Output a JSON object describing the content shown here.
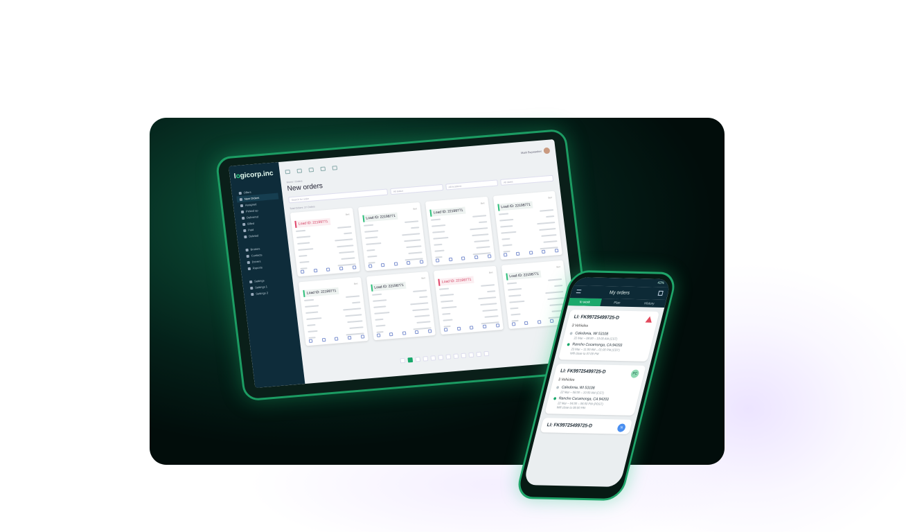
{
  "tablet": {
    "logo_prefix": "l",
    "logo_mid": "gicorp",
    "logo_suffix": ".inc",
    "user_name": "Mark Buyweeker",
    "breadcrumb": "Home / Orders",
    "page_title": "New orders",
    "filters": [
      "Search for order",
      "All status",
      "All locations",
      "All dates"
    ],
    "orders_label": "Total Orders: 37 Orders",
    "nav": [
      "Offers",
      "New Orders",
      "Assigned",
      "Picked up",
      "Delivered",
      "Billed",
      "Paid",
      "Deleted",
      "Brokers",
      "Contacts",
      "Drivers",
      "Reports",
      "Settings",
      "Settings 1",
      "Settings 2"
    ],
    "nav_active_index": 1,
    "orders": [
      {
        "load_id": "Load ID: 22198771",
        "alert": true
      },
      {
        "load_id": "Load ID: 22198771",
        "alert": false
      },
      {
        "load_id": "Load ID: 22198771",
        "alert": false
      },
      {
        "load_id": "Load ID: 22198771",
        "alert": false
      },
      {
        "load_id": "Load ID: 22198771",
        "alert": false
      },
      {
        "load_id": "Load ID: 22198771",
        "alert": false
      },
      {
        "load_id": "Load ID: 22198771",
        "alert": true
      },
      {
        "load_id": "Load ID: 22198771",
        "alert": false
      }
    ],
    "badge": "Bert",
    "pages": 12,
    "current_page": 2
  },
  "phone": {
    "battery": "42%",
    "title": "My orders",
    "tabs": [
      "In work",
      "Plan",
      "History"
    ],
    "active_tab": 0,
    "shipments": [
      {
        "id": "LI: FK99725499725-D",
        "vehicles": "3 Vehicles",
        "origin": "Caledonia, WI 53108",
        "origin_sub": "22 Mar – 08:00 – 10:00 AM (CST)",
        "dest": "Rancho Cucamonga, CA 94203",
        "dest_sub": "23 Mar – 11:00 AM – 01:00 PM (CDT)",
        "dest_note": "Will close to 07:00 PM",
        "marker": "warn"
      },
      {
        "id": "LI: FK99725499725-D",
        "vehicles": "3 Vehicles",
        "origin": "Caledonia, WI 53108",
        "origin_sub": "22 Mar – 08:00 – 10:00 AM (CST)",
        "dest": "Rancho Cucamonga, CA 94203",
        "dest_sub": "22 Mar – 04:00 – 06:00 PM (PDST)",
        "dest_note": "Will close to 05:00 PM",
        "marker": "PC"
      },
      {
        "id": "LI: FK99725499725-D",
        "marker": "N"
      }
    ]
  },
  "colors": {
    "accent": "#1aa86b",
    "alert": "#e0466b",
    "sidebar": "#0e2c3a"
  }
}
